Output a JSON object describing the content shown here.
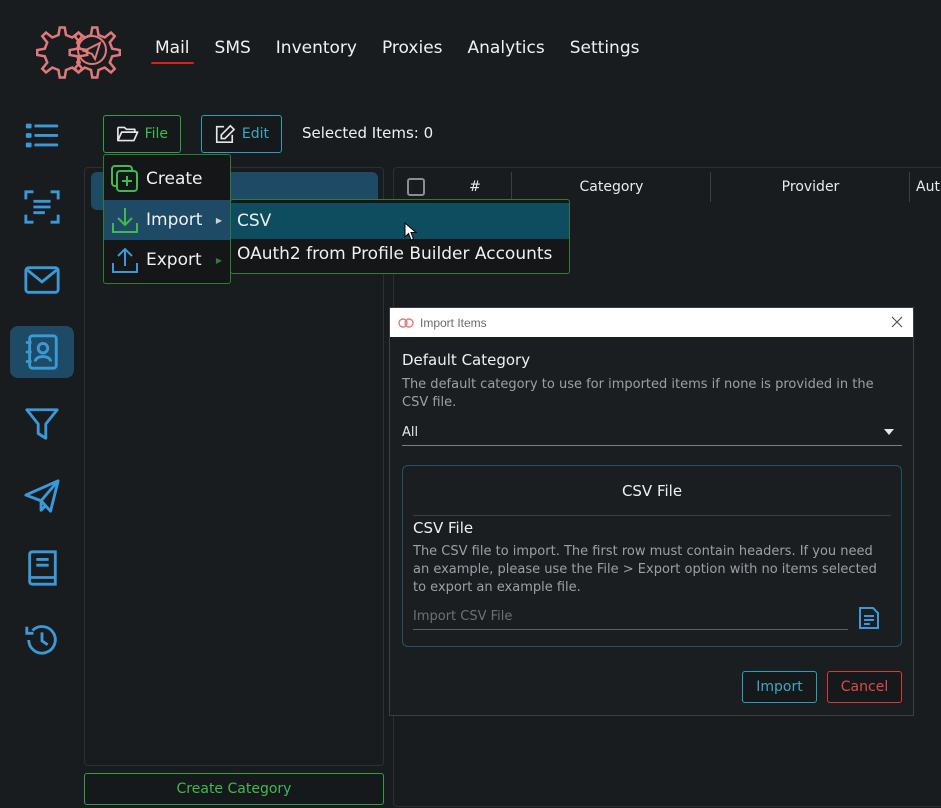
{
  "header": {
    "nav": [
      {
        "label": "Mail",
        "active": true
      },
      {
        "label": "SMS"
      },
      {
        "label": "Inventory"
      },
      {
        "label": "Proxies"
      },
      {
        "label": "Analytics"
      },
      {
        "label": "Settings"
      }
    ]
  },
  "sidebar": {
    "icons": [
      {
        "name": "list-icon"
      },
      {
        "name": "scan-text-icon"
      },
      {
        "name": "mail-icon"
      },
      {
        "name": "contacts-book-icon",
        "active": true
      },
      {
        "name": "filter-icon"
      },
      {
        "name": "send-icon"
      },
      {
        "name": "book-icon"
      },
      {
        "name": "history-icon"
      }
    ]
  },
  "toolbar": {
    "file_label": "File",
    "edit_label": "Edit",
    "selected_text": "Selected Items: 0"
  },
  "categories": {
    "create_label": "Create Category"
  },
  "table": {
    "columns": [
      "#",
      "Category",
      "Provider",
      "Auth"
    ]
  },
  "file_menu": {
    "items": [
      {
        "label": "Create",
        "icon": "add-box-icon"
      },
      {
        "label": "Import",
        "icon": "download-icon",
        "submenu": true,
        "active": true
      },
      {
        "label": "Export",
        "icon": "upload-icon",
        "submenu": true
      }
    ]
  },
  "import_submenu": {
    "items": [
      {
        "label": "CSV",
        "active": true
      },
      {
        "label": "OAuth2 from Profile Builder Accounts"
      }
    ]
  },
  "dialog": {
    "title": "Import Items",
    "default_category_label": "Default Category",
    "default_category_desc": "The default category to use for imported items if none is provided in the CSV file.",
    "default_category_value": "All",
    "csv_card_title": "CSV File",
    "csv_label": "CSV File",
    "csv_desc": "The CSV file to import. The first row must contain headers. If you need an example, please use the File > Export option with no items selected to export an example file.",
    "csv_placeholder": "Import CSV File",
    "import_label": "Import",
    "cancel_label": "Cancel"
  },
  "colors": {
    "accent_blue": "#3aa8c4",
    "accent_green": "#3fb950",
    "accent_red": "#e04848",
    "selected_bg": "#1f4a66",
    "background": "#191c1f"
  }
}
